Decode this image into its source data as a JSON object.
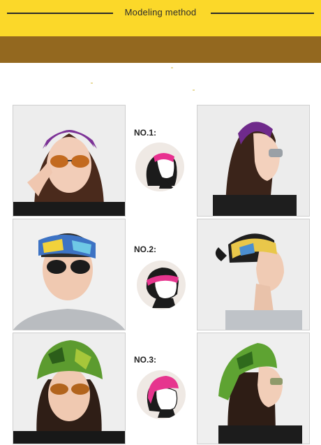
{
  "header": {
    "title": "Modeling method"
  },
  "methods": [
    {
      "label": "NO.1:",
      "band_color": "#e8308f"
    },
    {
      "label": "NO.2:",
      "band_color": "#e6358e"
    },
    {
      "label": "NO.3:",
      "band_color": "#e6358e"
    }
  ],
  "colors": {
    "banner": "#fbd829",
    "brown_bar": "#93681f",
    "accent_pink": "#e8308f"
  }
}
